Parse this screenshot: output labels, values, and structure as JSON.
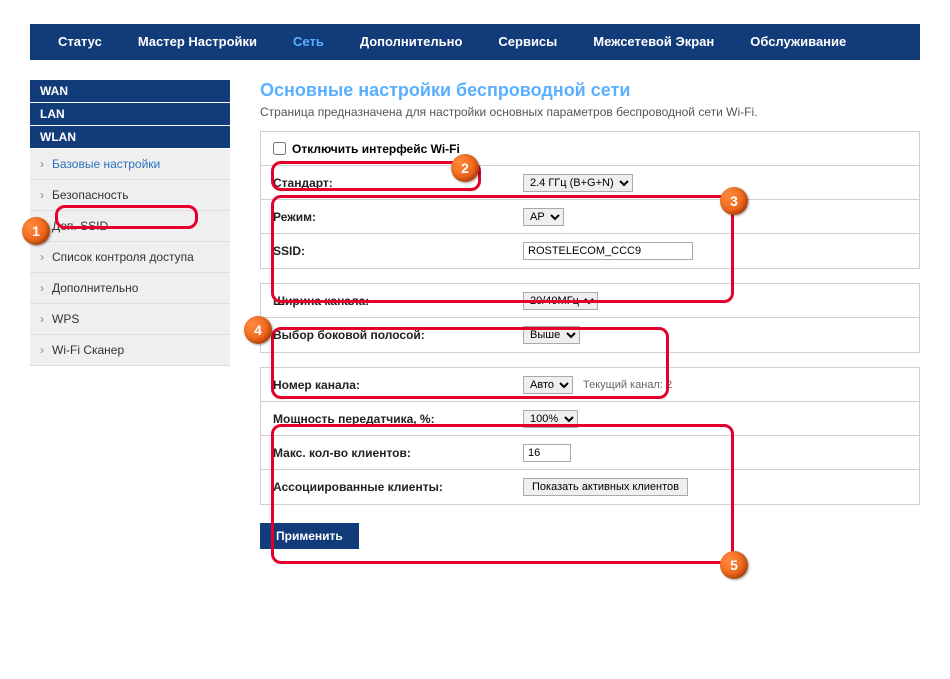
{
  "nav": {
    "status": "Статус",
    "wizard": "Мастер Настройки",
    "network": "Сеть",
    "advanced": "Дополнительно",
    "services": "Сервисы",
    "firewall": "Межсетевой Экран",
    "maintenance": "Обслуживание"
  },
  "sidebar": {
    "wan": "WAN",
    "lan": "LAN",
    "wlan": "WLAN",
    "items": {
      "basic": "Базовые настройки",
      "security": "Безопасность",
      "mssid": "Доп. SSID",
      "acl": "Список контроля доступа",
      "adv": "Дополнительно",
      "wps": "WPS",
      "scan": "Wi-Fi Сканер"
    }
  },
  "page": {
    "title": "Основные настройки беспроводной сети",
    "desc": "Страница предназначена для настройки основных параметров беспроводной сети Wi-Fi."
  },
  "form": {
    "disable_wifi": "Отключить интерфейс Wi-Fi",
    "standard_label": "Стандарт:",
    "standard_value": "2.4 ГГц (B+G+N)",
    "mode_label": "Режим:",
    "mode_value": "AP",
    "ssid_label": "SSID:",
    "ssid_value": "ROSTELECOM_CCC9",
    "chw_label": "Ширина канала:",
    "chw_value": "20/40МГц",
    "sideband_label": "Выбор боковой полосой:",
    "sideband_value": "Выше",
    "chnum_label": "Номер канала:",
    "chnum_value": "Авто",
    "chnum_current": "Текущий канал: 2",
    "txpower_label": "Мощность передатчика, %:",
    "txpower_value": "100%",
    "maxclients_label": "Макс. кол-во клиентов:",
    "maxclients_value": "16",
    "assoc_label": "Ассоциированные клиенты:",
    "assoc_button": "Показать активных клиентов",
    "apply": "Применить"
  },
  "badges": {
    "b1": "1",
    "b2": "2",
    "b3": "3",
    "b4": "4",
    "b5": "5"
  }
}
